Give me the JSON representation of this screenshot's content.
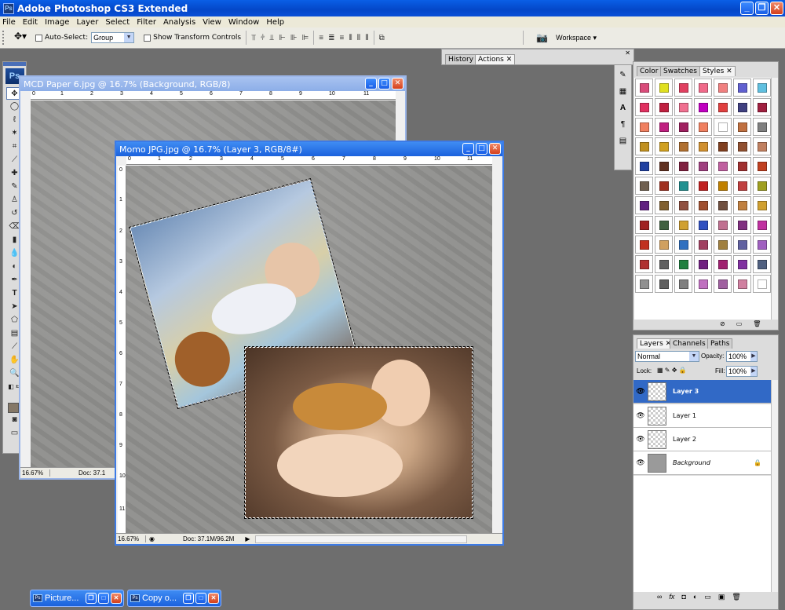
{
  "app": {
    "title": "Adobe Photoshop CS3 Extended",
    "logo": "Ps"
  },
  "menu": [
    "File",
    "Edit",
    "Image",
    "Layer",
    "Select",
    "Filter",
    "Analysis",
    "View",
    "Window",
    "Help"
  ],
  "options": {
    "auto_select_label": "Auto-Select:",
    "auto_select_value": "Group",
    "show_transform_label": "Show Transform Controls",
    "workspace_label": "Workspace ▾"
  },
  "panels": {
    "history_tab": "History",
    "actions_tab": "Actions",
    "color_tab": "Color",
    "swatches_tab": "Swatches",
    "styles_tab": "Styles",
    "layers_tab": "Layers",
    "channels_tab": "Channels",
    "paths_tab": "Paths"
  },
  "layers": {
    "blend_mode": "Normal",
    "opacity_label": "Opacity:",
    "opacity_value": "100%",
    "lock_label": "Lock:",
    "fill_label": "Fill:",
    "fill_value": "100%",
    "items": [
      {
        "name": "Layer 3",
        "selected": true
      },
      {
        "name": "Layer 1",
        "selected": false
      },
      {
        "name": "Layer 2",
        "selected": false
      },
      {
        "name": "Background",
        "selected": false,
        "locked": true
      }
    ]
  },
  "documents": {
    "back": {
      "title": "MCD Paper 6.jpg @ 16.7% (Background, RGB/8)",
      "zoom": "16.67%",
      "doc": "Doc: 37.1"
    },
    "front": {
      "title": "Momo JPG.jpg @ 16.7% (Layer 3, RGB/8#)",
      "zoom": "16.67%",
      "doc": "Doc: 37.1M/96.2M"
    }
  },
  "ruler_marks": [
    "0",
    "1",
    "2",
    "3",
    "4",
    "5",
    "6",
    "7",
    "8",
    "9",
    "10",
    "11"
  ],
  "taskbar": [
    {
      "label": "Picture..."
    },
    {
      "label": "Copy o..."
    }
  ],
  "style_colors": [
    "#d94c7a",
    "#e0e020",
    "#e04060",
    "#f06a8a",
    "#f08080",
    "#6060d0",
    "#60c0e0",
    "#e03060",
    "#c02040",
    "#f07090",
    "#c000c0",
    "#e04040",
    "#404080",
    "#a02040",
    "#f08060",
    "#c02080",
    "#a02060",
    "#f08060",
    "#ffffff",
    "#c07040",
    "#808080",
    "#c09020",
    "#d0a020",
    "#b07030",
    "#d09030",
    "#804020",
    "#905030",
    "#c08060",
    "#2040a0",
    "#603020",
    "#802040",
    "#a04080",
    "#c060a0",
    "#a03030",
    "#c04020",
    "#706050",
    "#a03020",
    "#209090",
    "#c02020",
    "#c08000",
    "#c04040",
    "#a0a020",
    "#602080",
    "#806030",
    "#905040",
    "#a05030",
    "#705040",
    "#c08040",
    "#d0a030",
    "#a02020",
    "#406040",
    "#d0a030",
    "#3050c0",
    "#c07090",
    "#803080",
    "#c030a0",
    "#c03020",
    "#d0a060",
    "#3070c0",
    "#a04060",
    "#a08040",
    "#6060a0",
    "#a060c0",
    "#b03030",
    "#606060",
    "#208040",
    "#702080",
    "#a02070",
    "#8030a0",
    "#506080",
    "#909090",
    "#606060",
    "#808080",
    "#c070c0",
    "#a060a0",
    "#d080a0",
    "#ffffff"
  ]
}
